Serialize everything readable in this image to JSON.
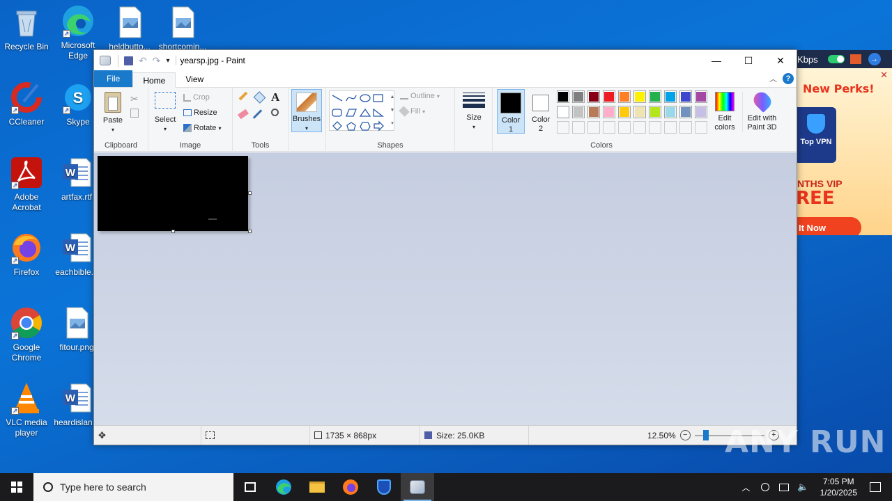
{
  "desktop": {
    "icons": [
      {
        "label": "Recycle Bin"
      },
      {
        "label": "Microsoft Edge"
      },
      {
        "label": "heldbutto..."
      },
      {
        "label": "shortcomin..."
      },
      {
        "label": "CCleaner"
      },
      {
        "label": "Skype"
      },
      {
        "label": "Adobe Acrobat"
      },
      {
        "label": "artfax.rtf"
      },
      {
        "label": "Firefox"
      },
      {
        "label": "eachbible..."
      },
      {
        "label": "Google Chrome"
      },
      {
        "label": "fitour.png"
      },
      {
        "label": "VLC media player"
      },
      {
        "label": "heardislan..."
      }
    ]
  },
  "ad": {
    "speed": "Kbps",
    "headline": "New Perks!",
    "product": "Top VPN",
    "promo1": "NTHS VIP",
    "promo2": "REE",
    "cta": "It Now"
  },
  "paint": {
    "title": "yearsp.jpg - Paint",
    "tabs": {
      "file": "File",
      "home": "Home",
      "view": "View"
    },
    "clipboard": {
      "paste": "Paste",
      "label": "Clipboard"
    },
    "image": {
      "select": "Select",
      "crop": "Crop",
      "resize": "Resize",
      "rotate": "Rotate",
      "label": "Image"
    },
    "tools": {
      "label": "Tools"
    },
    "brushes": {
      "label": "Brushes"
    },
    "shapes": {
      "outline": "Outline",
      "fill": "Fill",
      "label": "Shapes"
    },
    "size": {
      "label": "Size"
    },
    "colors": {
      "color1": "Color 1",
      "color2": "Color 2",
      "edit": "Edit colors",
      "paint3d": "Edit with Paint 3D",
      "label": "Colors",
      "row1": [
        "#000000",
        "#7f7f7f",
        "#880015",
        "#ed1c24",
        "#ff7f27",
        "#fff200",
        "#22b14c",
        "#00a2e8",
        "#3f48cc",
        "#a349a4"
      ],
      "row2": [
        "#ffffff",
        "#c3c3c3",
        "#b97a57",
        "#ffaec9",
        "#ffc90e",
        "#efe4b0",
        "#b5e61d",
        "#99d9ea",
        "#7092be",
        "#c8bfe7"
      ],
      "row3": [
        "",
        "",
        "",
        "",
        "",
        "",
        "",
        "",
        "",
        ""
      ]
    },
    "status": {
      "dimensions": "1735 × 868px",
      "size": "Size: 25.0KB",
      "zoom": "12.50%"
    }
  },
  "taskbar": {
    "search_placeholder": "Type here to search",
    "time": "7:05 PM",
    "date": "1/20/2025"
  },
  "watermark": "ANY RUN"
}
